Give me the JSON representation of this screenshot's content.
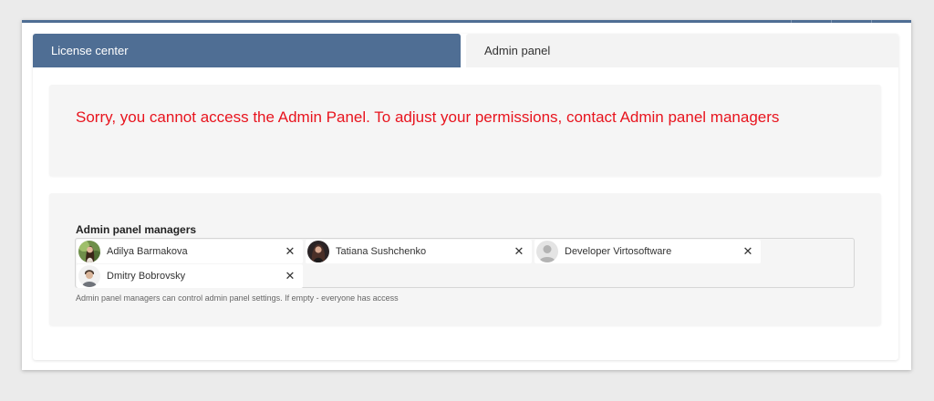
{
  "tabs": [
    {
      "label": "License center",
      "active": true
    },
    {
      "label": "Admin panel",
      "active": false
    }
  ],
  "notice": {
    "text": "Sorry, you cannot access the Admin Panel. To adjust your permissions, contact Admin panel managers",
    "color": "#e8141e"
  },
  "managers": {
    "title": "Admin panel managers",
    "remove_glyph": "✕",
    "people": [
      {
        "name": "Adilya Barmakova",
        "avatar": "photo-avatar"
      },
      {
        "name": "Tatiana Sushchenko",
        "avatar": "photo-avatar"
      },
      {
        "name": "Developer Virtosoftware",
        "avatar": "default-user-icon"
      },
      {
        "name": "Dmitry Bobrovsky",
        "avatar": "photo-avatar"
      }
    ],
    "hint": "Admin panel managers can control admin panel settings. If empty - everyone has access"
  },
  "colors": {
    "accent": "#4f6e94",
    "error": "#e8141e"
  }
}
